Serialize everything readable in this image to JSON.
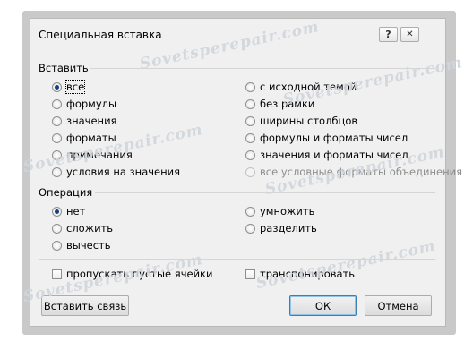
{
  "dialog": {
    "title": "Специальная вставка",
    "help_label": "?",
    "close_label": "✕"
  },
  "paste": {
    "label": "Вставить",
    "left": [
      "все",
      "формулы",
      "значения",
      "форматы",
      "примечания",
      "условия на значения"
    ],
    "right": [
      "с исходной темой",
      "без рамки",
      "ширины столбцов",
      "формулы и форматы чисел",
      "значения и форматы чисел",
      "все условные форматы объединения"
    ],
    "selected": "все"
  },
  "operation": {
    "label": "Операция",
    "left": [
      "нет",
      "сложить",
      "вычесть"
    ],
    "right": [
      "умножить",
      "разделить"
    ],
    "selected": "нет"
  },
  "checkboxes": {
    "skip_blanks": "пропускать пустые ячейки",
    "transpose": "транспонировать"
  },
  "buttons": {
    "paste_link": "Вставить связь",
    "ok": "ОК",
    "cancel": "Отмена"
  },
  "watermark": "Sovetsperepair.com"
}
